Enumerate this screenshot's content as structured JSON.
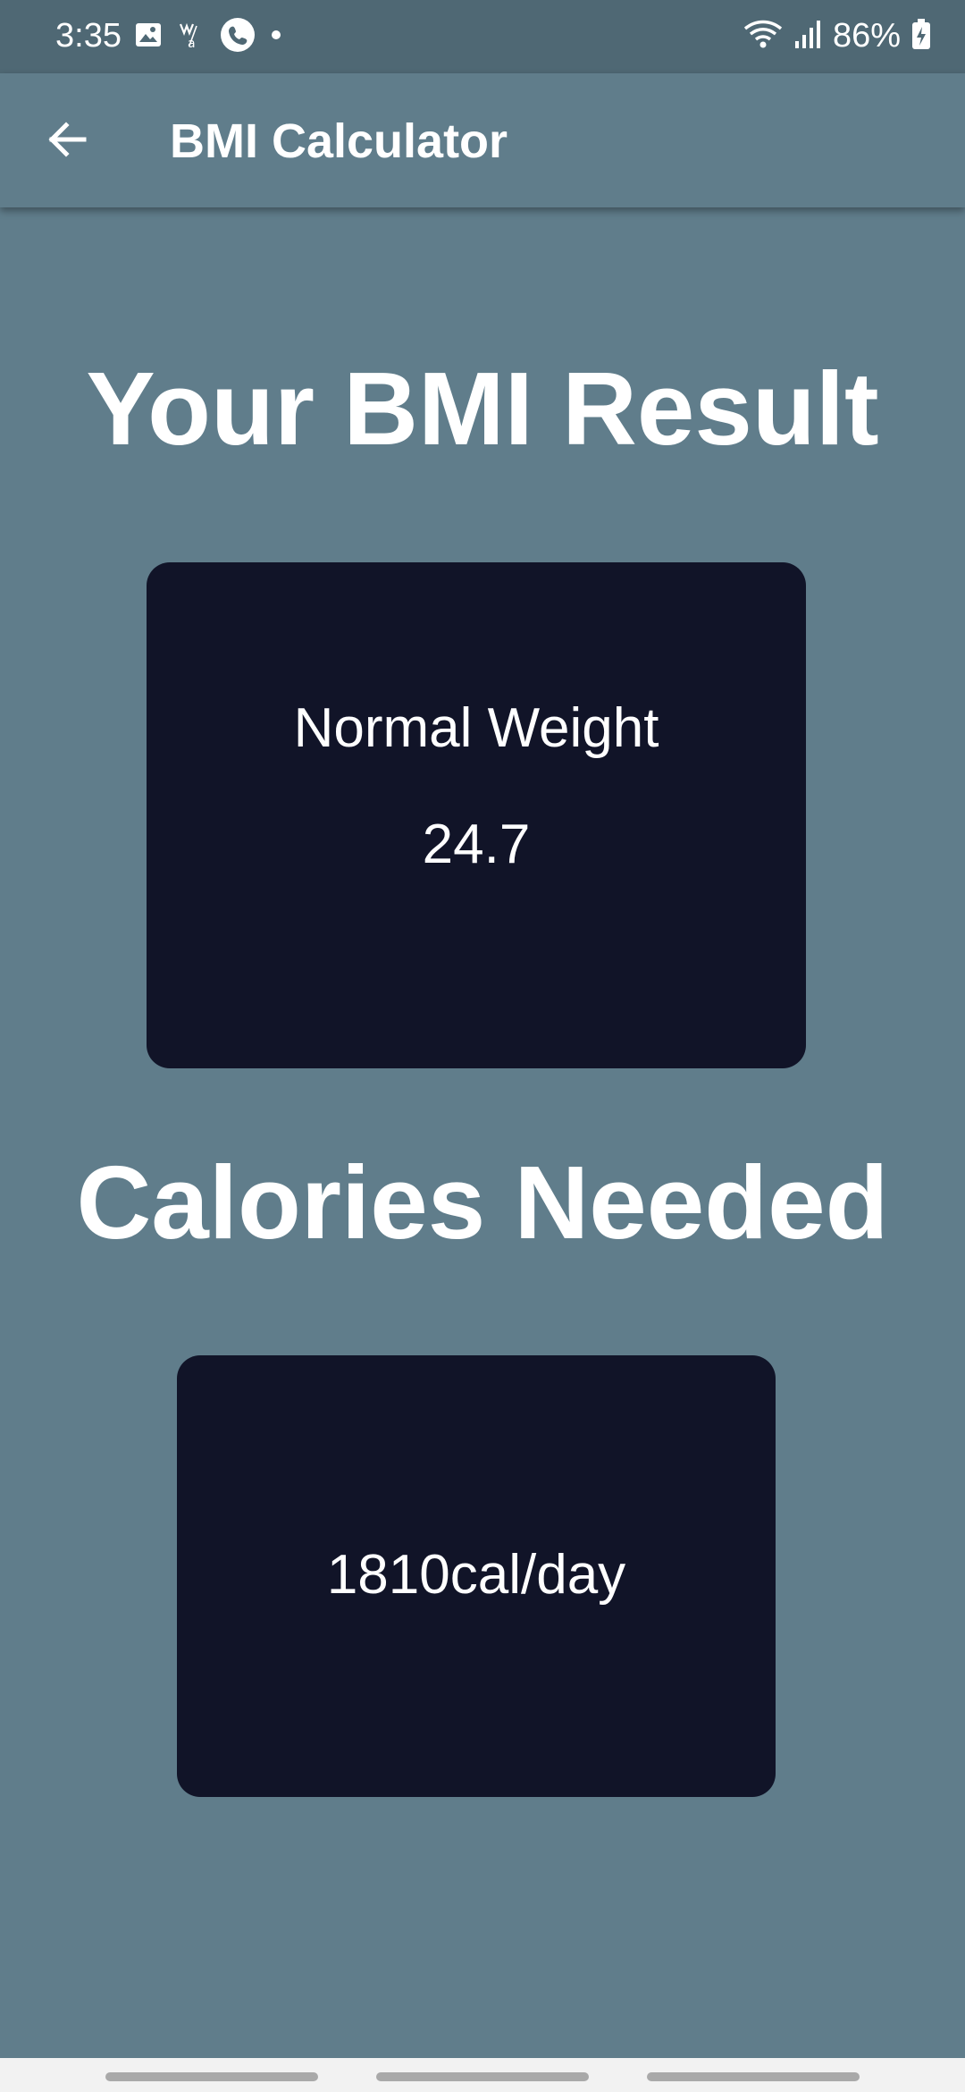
{
  "status_bar": {
    "time": "3:35",
    "battery": "86%",
    "icons_left": [
      "image-icon",
      "wifi-calling-icon",
      "phone-icon",
      "dot-icon"
    ],
    "icons_right": [
      "wifi-icon",
      "signal-icon",
      "battery-charging-icon"
    ]
  },
  "app_bar": {
    "title": "BMI Calculator",
    "back_icon": "arrow-left-icon"
  },
  "main": {
    "bmi_heading": "Your BMI Result",
    "bmi_category": "Normal Weight",
    "bmi_value": "24.7",
    "calories_heading": "Calories Needed",
    "calories_value": "1810cal/day"
  },
  "colors": {
    "background": "#607d8b",
    "status_bar": "#4f6874",
    "card": "#111428",
    "text": "#ffffff"
  }
}
